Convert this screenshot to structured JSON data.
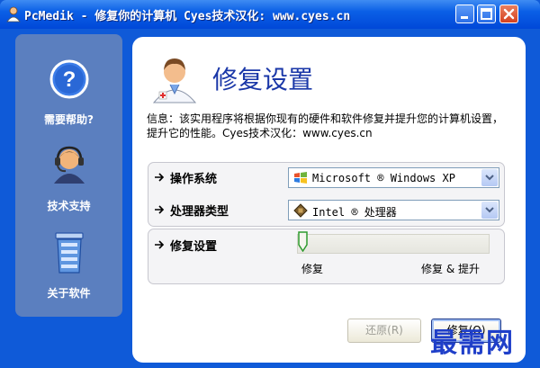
{
  "window": {
    "title": "PcMedik - 修复你的计算机 Cyes技术汉化: www.cyes.cn"
  },
  "sidebar": {
    "items": [
      {
        "label": "需要帮助?",
        "icon": "help-icon"
      },
      {
        "label": "技术支持",
        "icon": "support-headset-icon"
      },
      {
        "label": "关于软件",
        "icon": "about-trash-icon"
      }
    ]
  },
  "main": {
    "title": "修复设置",
    "info": "信息：该实用程序将根据你现有的硬件和软件修复并提升您的计算机设置，提升它的性能。Cyes技术汉化：www.cyes.cn",
    "os_label": "操作系统",
    "os_value": "Microsoft ® Windows XP",
    "cpu_label": "处理器类型",
    "cpu_value": "Intel ® 处理器",
    "repair_label": "修复设置",
    "slider": {
      "value": 0,
      "left_label": "修复",
      "right_label": "修复 & 提升"
    },
    "restore_button": "还原(R)",
    "repair_button": "修复(O)"
  },
  "watermark": "最需网",
  "colors": {
    "titlebar": "#0b5fe6",
    "sidebar": "#5b7fbf",
    "title_text": "#1a37a8",
    "window_bg": "#0f5ad8"
  }
}
